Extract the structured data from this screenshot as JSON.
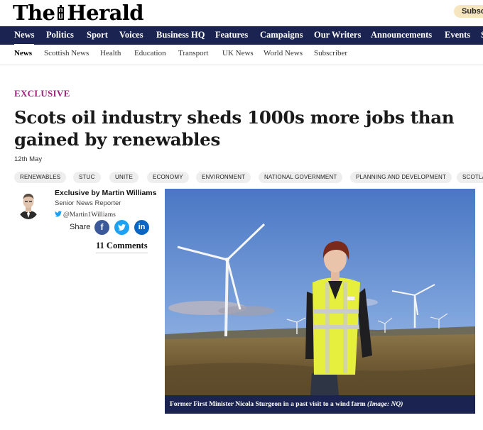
{
  "masthead": {
    "logo_the": "The",
    "logo_herald": "Herald",
    "subscribe_label": "Subscr"
  },
  "primary_nav": [
    "News",
    "Politics",
    "Sport",
    "Voices",
    "Business HQ",
    "Features",
    "Campaigns",
    "Our Writers",
    "Announcements",
    "Events",
    "S"
  ],
  "secondary_nav": [
    "News",
    "Scottish News",
    "Health",
    "Education",
    "Transport",
    "UK News",
    "World News",
    "Subscriber"
  ],
  "article": {
    "kicker": "EXCLUSIVE",
    "headline": "Scots oil industry sheds 1000s more jobs than gained by renewables",
    "date": "12th May",
    "tags": [
      "RENEWABLES",
      "STUC",
      "UNITE",
      "ECONOMY",
      "ENVIRONMENT",
      "NATIONAL GOVERNMENT",
      "PLANNING AND DEVELOPMENT",
      "SCOTLA"
    ]
  },
  "byline": {
    "name": "Exclusive by Martin Williams",
    "role": "Senior News Reporter",
    "twitter": "@Martin1Williams",
    "share_label": "Share",
    "comments": "11 Comments"
  },
  "image": {
    "caption_text": "Former First Minister Nicola Sturgeon in a past visit to a wind farm",
    "caption_credit": "(Image: NQ)"
  },
  "icons": {
    "facebook": "facebook-icon",
    "twitter": "twitter-icon",
    "linkedin": "linkedin-icon"
  },
  "colors": {
    "nav_bg": "#1b2450",
    "kicker": "#a0207a",
    "subscribe_bg": "#f6e6bf",
    "facebook": "#3b5998",
    "twitter": "#1da1f2",
    "linkedin": "#0a66c2"
  }
}
